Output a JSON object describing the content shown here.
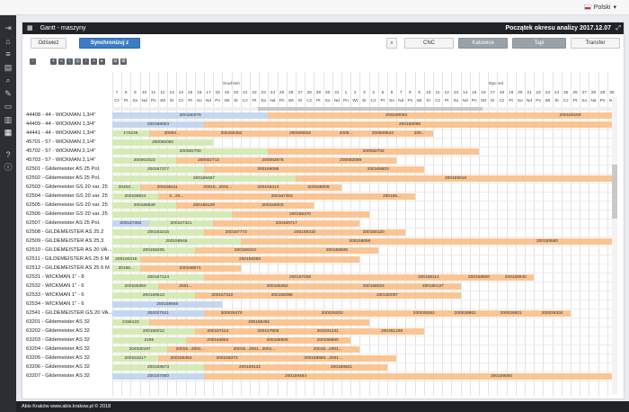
{
  "lang": "Polski",
  "nav_icons": [
    "logout-icon",
    "home-icon",
    "list-icon",
    "table-icon",
    "search-icon",
    "wrench-icon",
    "monitor-icon",
    "chart-icon",
    "gantt-icon",
    "help-icon",
    "info-icon"
  ],
  "panel": {
    "title": "Gantt - maszyny",
    "start_label": "Początek okresu analizy 2017.12.07"
  },
  "buttons": {
    "refresh": "Odśwież",
    "sync": "Synchronizuj z produkcją",
    "cnc": "CNC",
    "katowice": "Katowice",
    "tapi": "Tapi",
    "transfer": "Transfer"
  },
  "months": [
    "Grudzień",
    "Styczeń"
  ],
  "days": [
    "7",
    "8",
    "9",
    "10",
    "11",
    "12",
    "13",
    "14",
    "15",
    "16",
    "17",
    "18",
    "19",
    "20",
    "21",
    "22",
    "23",
    "24",
    "25",
    "26",
    "27",
    "28",
    "29",
    "30",
    "31",
    "1",
    "2",
    "3",
    "4",
    "5",
    "6",
    "7",
    "8",
    "9",
    "10",
    "11",
    "12",
    "13",
    "14",
    "15",
    "16",
    "17",
    "18",
    "19",
    "20",
    "21",
    "22",
    "23",
    "24",
    "25",
    "26",
    "27",
    "28",
    "29",
    "30"
  ],
  "daynames": [
    "Cz",
    "Pt",
    "So",
    "Nd",
    "Pn",
    "Wt",
    "Śr",
    "Cz",
    "Pt",
    "So",
    "Nd",
    "Pn",
    "Wt",
    "Śr",
    "Cz",
    "Pt",
    "So",
    "Nd",
    "Pn",
    "Wt",
    "Śr",
    "Cz",
    "Pt",
    "So",
    "Nd",
    "Pn",
    "Wt",
    "Śr",
    "Cz",
    "Pt",
    "So",
    "Nd",
    "Pn",
    "Wt",
    "Śr",
    "Cz",
    "Pt",
    "So",
    "Nd",
    "Pn",
    "Wt",
    "Śr",
    "Cz",
    "Pt",
    "So",
    "Nd",
    "Pn",
    "Wt",
    "Śr",
    "Cz",
    "Pt",
    "So",
    "Nd",
    "Pn",
    "Wt"
  ],
  "rows": [
    {
      "label": "44408 - 44 - WICKMAN 1,3/4\"",
      "bars": [
        {
          "s": 0,
          "w": 17,
          "c": "b-blue",
          "t": "200160079"
        },
        {
          "s": 17,
          "w": 28,
          "c": "b-orange",
          "t": "200160094"
        },
        {
          "s": 45,
          "w": 10,
          "c": "b-orange",
          "t": "200160159"
        }
      ]
    },
    {
      "label": "44409 - 44 - WICKMAN 1,3/4\"",
      "bars": [
        {
          "s": 0,
          "w": 10,
          "c": "b-blue",
          "t": "200168004"
        },
        {
          "s": 10,
          "w": 45,
          "c": "b-orange",
          "t": "200160095"
        }
      ]
    },
    {
      "label": "44441 - 44 - WICKMAN 1,3/4\"",
      "bars": [
        {
          "s": 0,
          "w": 4,
          "c": "b-green",
          "t": "170236"
        },
        {
          "s": 4,
          "w": 5,
          "c": "b-orange",
          "t": "20063..."
        },
        {
          "s": 9,
          "w": 8,
          "c": "b-orange",
          "t": "200158452"
        },
        {
          "s": 17,
          "w": 7,
          "c": "b-orange",
          "t": "200508822"
        },
        {
          "s": 24,
          "w": 3,
          "c": "b-orange",
          "t": "2008..."
        },
        {
          "s": 27,
          "w": 5,
          "c": "b-orange",
          "t": "200508543"
        },
        {
          "s": 32,
          "w": 3,
          "c": "b-orange",
          "t": "200..."
        }
      ]
    },
    {
      "label": "45701 - 57 - WICKMAN 2,1/4\"",
      "bars": [
        {
          "s": 0,
          "w": 11,
          "c": "b-green",
          "t": "200082082"
        }
      ]
    },
    {
      "label": "45702 - 57 - WICKMAN 2,1/4\"",
      "bars": [
        {
          "s": 0,
          "w": 17,
          "c": "b-green",
          "t": "200082700"
        },
        {
          "s": 17,
          "w": 23,
          "c": "b-orange",
          "t": "200082702"
        }
      ]
    },
    {
      "label": "45703 - 57 - WICKMAN 2,1/4\"",
      "bars": [
        {
          "s": 0,
          "w": 7,
          "c": "b-green",
          "t": "200002023"
        },
        {
          "s": 7,
          "w": 7,
          "c": "b-orange",
          "t": "200002712"
        },
        {
          "s": 14,
          "w": 7,
          "c": "b-orange",
          "t": "200082676"
        },
        {
          "s": 21,
          "w": 10,
          "c": "b-orange",
          "t": "200082089"
        }
      ]
    },
    {
      "label": "62501 - Gildemeister AS 25 Pol.",
      "bars": [
        {
          "s": 0,
          "w": 10,
          "c": "b-green",
          "t": "200167377"
        },
        {
          "s": 10,
          "w": 14,
          "c": "b-orange",
          "t": "200169089"
        },
        {
          "s": 24,
          "w": 10,
          "c": "b-orange",
          "t": "200169503"
        }
      ]
    },
    {
      "label": "62502 - Gildemeister AS 25 Pol.",
      "bars": [
        {
          "s": 0,
          "w": 20,
          "c": "b-green",
          "t": "200169487"
        },
        {
          "s": 20,
          "w": 35,
          "c": "b-orange",
          "t": "200169016"
        }
      ]
    },
    {
      "label": "62503 - Gildemeister GS 20 var. 25",
      "bars": [
        {
          "s": 0,
          "w": 3,
          "c": "b-green",
          "t": "20403..."
        },
        {
          "s": 3,
          "w": 6,
          "c": "b-orange",
          "t": "200158111"
        },
        {
          "s": 9,
          "w": 5,
          "c": "b-orange",
          "t": "20015...2001..."
        },
        {
          "s": 14,
          "w": 6,
          "c": "b-orange",
          "t": "200158413"
        },
        {
          "s": 20,
          "w": 5,
          "c": "b-orange",
          "t": "200168008"
        }
      ]
    },
    {
      "label": "62504 - Gildemeister GS 20 var. 25",
      "bars": [
        {
          "s": 0,
          "w": 5,
          "c": "b-green",
          "t": "200168844"
        },
        {
          "s": 5,
          "w": 4,
          "c": "b-orange",
          "t": "2...20..."
        },
        {
          "s": 9,
          "w": 19,
          "c": "b-orange",
          "t": "200167353"
        },
        {
          "s": 28,
          "w": 5,
          "c": "b-orange",
          "t": "200155..."
        }
      ]
    },
    {
      "label": "62505 - Gildemeister GS 20 var. 25",
      "bars": [
        {
          "s": 0,
          "w": 7,
          "c": "b-green",
          "t": "200168539"
        },
        {
          "s": 7,
          "w": 6,
          "c": "b-orange",
          "t": "200158129"
        },
        {
          "s": 13,
          "w": 9,
          "c": "b-orange",
          "t": "200158003"
        }
      ]
    },
    {
      "label": "62506 - Gildemeister GS 20 var. 25",
      "bars": [
        {
          "s": 0,
          "w": 13,
          "c": "b-green",
          "t": ""
        },
        {
          "s": 13,
          "w": 15,
          "c": "b-orange",
          "t": "200156470"
        }
      ]
    },
    {
      "label": "62507 - Gildemeister AS 25 Pol.",
      "bars": [
        {
          "s": 0,
          "w": 4,
          "c": "b-blue",
          "t": "200167392"
        },
        {
          "s": 4,
          "w": 7,
          "c": "b-green",
          "t": "200167321"
        },
        {
          "s": 11,
          "w": 16,
          "c": "b-orange",
          "t": "200160717"
        }
      ]
    },
    {
      "label": "62508 - GILDEMEISTER AS 25.2",
      "bars": [
        {
          "s": 0,
          "w": 10,
          "c": "b-green",
          "t": "200153215"
        },
        {
          "s": 10,
          "w": 7,
          "c": "b-orange",
          "t": "200157773"
        },
        {
          "s": 17,
          "w": 8,
          "c": "b-orange",
          "t": "200159310"
        },
        {
          "s": 25,
          "w": 7,
          "c": "b-orange",
          "t": "200158120"
        }
      ]
    },
    {
      "label": "62509 - GILDEMEISTER AS 25.3",
      "bars": [
        {
          "s": 0,
          "w": 14,
          "c": "b-green",
          "t": "200158946"
        },
        {
          "s": 14,
          "w": 26,
          "c": "b-orange",
          "t": "200158099"
        },
        {
          "s": 40,
          "w": 15,
          "c": "b-orange",
          "t": "200159580"
        }
      ]
    },
    {
      "label": "62510 - GILDEMEISTER AS 20 VA...",
      "bars": [
        {
          "s": 0,
          "w": 9,
          "c": "b-green",
          "t": "200158205"
        },
        {
          "s": 9,
          "w": 11,
          "c": "b-orange",
          "t": "200159310"
        },
        {
          "s": 20,
          "w": 9,
          "c": "b-orange",
          "t": "200158609"
        }
      ]
    },
    {
      "label": "62511 - GILDEMEISTER AS 25 6 M",
      "bars": [
        {
          "s": 0,
          "w": 3,
          "c": "b-green",
          "t": "200160316"
        },
        {
          "s": 3,
          "w": 24,
          "c": "b-orange",
          "t": "200158358"
        }
      ]
    },
    {
      "label": "62512 - GILDEMEISTER AS 25 6 M",
      "bars": [
        {
          "s": 0,
          "w": 3,
          "c": "b-green",
          "t": "20155..."
        },
        {
          "s": 3,
          "w": 11,
          "c": "b-orange",
          "t": "200158071"
        }
      ]
    },
    {
      "label": "62531 - WICKMAN 1\" - 8",
      "bars": [
        {
          "s": 0,
          "w": 10,
          "c": "b-green",
          "t": "200157124"
        },
        {
          "s": 10,
          "w": 21,
          "c": "b-orange",
          "t": "200157008"
        },
        {
          "s": 31,
          "w": 7,
          "c": "b-orange",
          "t": "200158114"
        },
        {
          "s": 38,
          "w": 4,
          "c": "b-orange",
          "t": "200158500"
        },
        {
          "s": 42,
          "w": 4,
          "c": "b-orange",
          "t": "200158940"
        }
      ]
    },
    {
      "label": "62532 - WICKMAN 1\" - 6",
      "bars": [
        {
          "s": 0,
          "w": 5,
          "c": "b-green",
          "t": "200158360"
        },
        {
          "s": 5,
          "w": 6,
          "c": "b-orange",
          "t": "2001..."
        },
        {
          "s": 11,
          "w": 14,
          "c": "b-orange",
          "t": "200159462"
        },
        {
          "s": 25,
          "w": 7,
          "c": "b-orange",
          "t": "200158023"
        },
        {
          "s": 32,
          "w": 6,
          "c": "b-orange",
          "t": "200160127"
        }
      ]
    },
    {
      "label": "62533 - WICKMAN 1\" - 6",
      "bars": [
        {
          "s": 0,
          "w": 9,
          "c": "b-green",
          "t": "200159513"
        },
        {
          "s": 9,
          "w": 6,
          "c": "b-orange",
          "t": "200157310"
        },
        {
          "s": 15,
          "w": 7,
          "c": "b-orange",
          "t": "200158098"
        },
        {
          "s": 22,
          "w": 16,
          "c": "b-orange",
          "t": "200160097"
        }
      ]
    },
    {
      "label": "62534 - WICKMAN 1\" - 6",
      "bars": [
        {
          "s": 0,
          "w": 12,
          "c": "b-blue",
          "t": "200158946"
        }
      ]
    },
    {
      "label": "62541 - GILDEMEISTER GS 20 VA...",
      "bars": [
        {
          "s": 0,
          "w": 10,
          "c": "b-blue",
          "t": "200027521"
        },
        {
          "s": 10,
          "w": 6,
          "c": "b-orange",
          "t": "200028470"
        },
        {
          "s": 16,
          "w": 16,
          "c": "b-orange",
          "t": "200026202"
        },
        {
          "s": 32,
          "w": 4,
          "c": "b-orange",
          "t": "200028262"
        },
        {
          "s": 36,
          "w": 5,
          "c": "b-orange",
          "t": "200028861"
        },
        {
          "s": 41,
          "w": 5,
          "c": "b-orange",
          "t": "200026601"
        },
        {
          "s": 46,
          "w": 4,
          "c": "b-orange",
          "t": "200026334"
        }
      ]
    },
    {
      "label": "63201 - Gildemeister AS 32",
      "bars": [
        {
          "s": 0,
          "w": 4,
          "c": "b-green",
          "t": "2155123"
        },
        {
          "s": 4,
          "w": 24,
          "c": "b-orange",
          "t": "200158491"
        }
      ]
    },
    {
      "label": "63202 - Gildemeister AS 32",
      "bars": [
        {
          "s": 0,
          "w": 9,
          "c": "b-green",
          "t": "200160012"
        },
        {
          "s": 9,
          "w": 5,
          "c": "b-orange",
          "t": "200157114"
        },
        {
          "s": 14,
          "w": 6,
          "c": "b-orange",
          "t": "200157805"
        },
        {
          "s": 20,
          "w": 7,
          "c": "b-orange",
          "t": "204031231"
        },
        {
          "s": 27,
          "w": 7,
          "c": "b-orange",
          "t": "200451228"
        }
      ]
    },
    {
      "label": "63203 - Gildemeister AS 32",
      "bars": [
        {
          "s": 0,
          "w": 8,
          "c": "b-green",
          "t": "2186"
        },
        {
          "s": 8,
          "w": 7,
          "c": "b-orange",
          "t": "200164864"
        },
        {
          "s": 15,
          "w": 6,
          "c": "b-orange",
          "t": "200158505"
        },
        {
          "s": 21,
          "w": 5,
          "c": "b-orange",
          "t": "200158660"
        }
      ]
    },
    {
      "label": "63204 - Gildemeister AS 32",
      "bars": [
        {
          "s": 0,
          "w": 6,
          "c": "b-green",
          "t": "204030197"
        },
        {
          "s": 6,
          "w": 5,
          "c": "b-orange",
          "t": "20015...2001..."
        },
        {
          "s": 11,
          "w": 9,
          "c": "b-orange",
          "t": "20015...2001...2001..."
        },
        {
          "s": 20,
          "w": 7,
          "c": "b-orange",
          "t": "20015...2001..."
        }
      ]
    },
    {
      "label": "63205 - Gildemeister AS 32",
      "bars": [
        {
          "s": 0,
          "w": 5,
          "c": "b-green",
          "t": "200153217"
        },
        {
          "s": 5,
          "w": 5,
          "c": "b-orange",
          "t": "200158464"
        },
        {
          "s": 10,
          "w": 5,
          "c": "b-orange",
          "t": "200158373"
        },
        {
          "s": 15,
          "w": 16,
          "c": "b-orange",
          "t": "200158860...2001..."
        }
      ]
    },
    {
      "label": "63206 - Gildemeister AS 32",
      "bars": [
        {
          "s": 0,
          "w": 10,
          "c": "b-green",
          "t": "200158673"
        },
        {
          "s": 10,
          "w": 10,
          "c": "b-orange",
          "t": "200158132"
        },
        {
          "s": 20,
          "w": 10,
          "c": "b-orange",
          "t": "200158501"
        }
      ]
    },
    {
      "label": "63207 - Gildemeister AS 32",
      "bars": [
        {
          "s": 0,
          "w": 10,
          "c": "b-blue",
          "t": "200157000"
        },
        {
          "s": 10,
          "w": 20,
          "c": "b-orange",
          "t": "200159464"
        },
        {
          "s": 30,
          "w": 25,
          "c": "b-orange",
          "t": "200159000"
        }
      ]
    }
  ],
  "footer": "Abis Kraków www.abis.krakow.pl © 2018"
}
